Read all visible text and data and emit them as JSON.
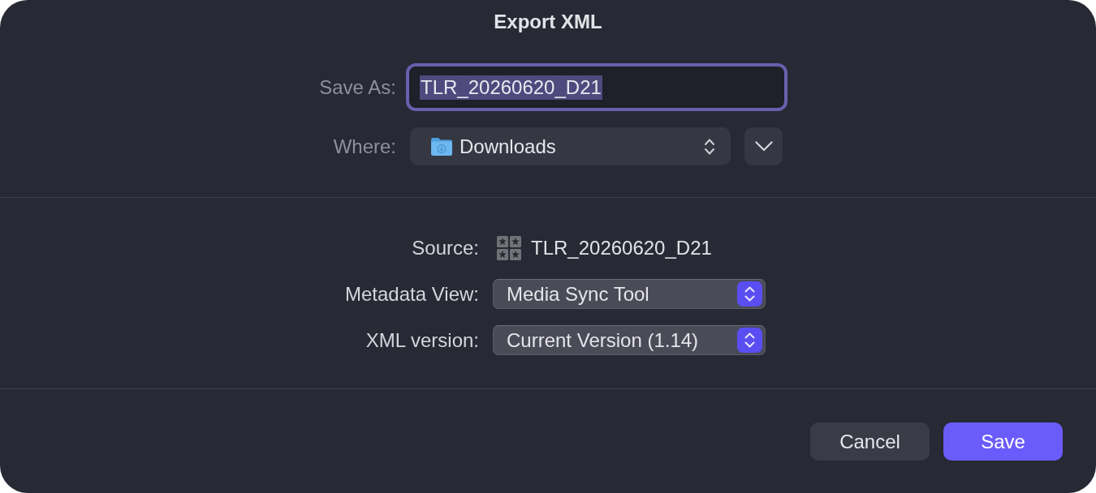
{
  "window": {
    "title": "Export XML"
  },
  "save_as": {
    "label": "Save As:",
    "value": "TLR_20260620_D21",
    "focused": true,
    "text_selected": true
  },
  "where": {
    "label": "Where:",
    "value": "Downloads"
  },
  "options": [
    {
      "kind": "file",
      "label": "Source:",
      "value": "TLR_20260620_D21"
    },
    {
      "kind": "popup",
      "label": "Metadata View:",
      "value": "Media Sync Tool"
    },
    {
      "kind": "popup",
      "label": "XML version:",
      "value": "Current Version (1.14)"
    }
  ],
  "buttons": [
    {
      "kind": "secondary",
      "label": "Cancel"
    },
    {
      "kind": "primary",
      "label": "Save"
    }
  ]
}
